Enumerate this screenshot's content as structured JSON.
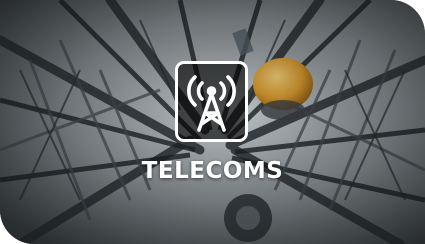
{
  "tile": {
    "label": "TELECOMS",
    "icon": "radio-tower-icon",
    "background": "telecom-tower-lattice-photo"
  },
  "colors": {
    "label": "#ffffff",
    "icon_stroke": "#ffffff",
    "icon_box_fill": "#000000",
    "photo_tone": "#5d656a"
  }
}
